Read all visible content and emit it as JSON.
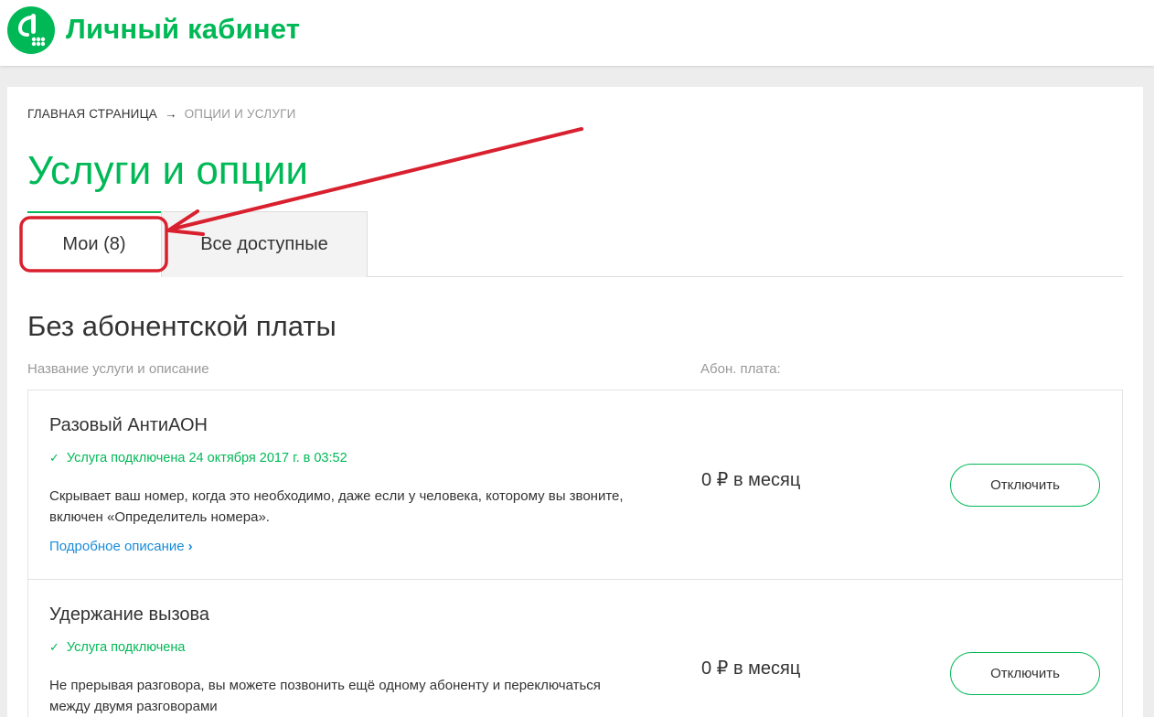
{
  "header": {
    "title": "Личный кабинет",
    "logo_icon": "megafon-logo-icon",
    "brand_color": "#00b956"
  },
  "breadcrumb": {
    "home": "ГЛАВНАЯ СТРАНИЦА",
    "separator": "→",
    "current": "ОПЦИИ И УСЛУГИ"
  },
  "page": {
    "title": "Услуги и опции"
  },
  "tabs": [
    {
      "label": "Мои (8)",
      "active": true
    },
    {
      "label": "Все доступные",
      "active": false
    }
  ],
  "section": {
    "title": "Без абонентской платы",
    "col_name": "Название услуги и описание",
    "col_fee": "Абон. плата:"
  },
  "services": [
    {
      "name": "Разовый АнтиАОН",
      "status": "Услуга подключена 24 октября 2017 г. в 03:52",
      "description": "Скрывает ваш номер, когда это необходимо, даже если у человека, которому вы звоните, включен «Определитель номера».",
      "more_link": "Подробное описание",
      "fee": "0 ₽ в месяц",
      "button": "Отключить"
    },
    {
      "name": "Удержание вызова",
      "status": "Услуга подключена",
      "description": "Не прерывая разговора, вы можете позвонить ещё одному абоненту и переключаться между двумя разговорами",
      "fee": "0 ₽ в месяц",
      "button": "Отключить"
    }
  ],
  "annotation": {
    "color": "#d9202e"
  }
}
